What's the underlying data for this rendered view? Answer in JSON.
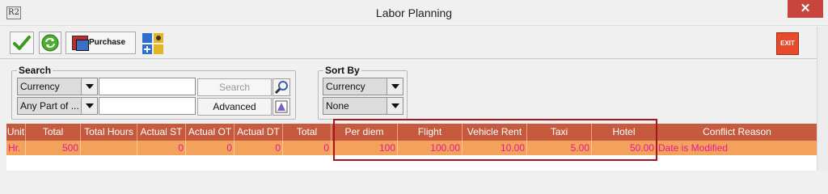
{
  "window": {
    "title": "Labor Planning",
    "close_glyph": "✕",
    "app_icon_text": "R2"
  },
  "toolbar": {
    "purchase_label": "Purchase",
    "exit_label": "EXIT"
  },
  "search": {
    "legend": "Search",
    "field_select": "Currency",
    "match_select": "Any Part of ...",
    "search_label": "Search",
    "advanced_label": "Advanced"
  },
  "sort": {
    "legend": "Sort By",
    "primary": "Currency",
    "secondary": "None"
  },
  "grid": {
    "columns": [
      "Unit",
      "Total",
      "Total Hours",
      "Actual ST",
      "Actual OT",
      "Actual DT",
      "Total",
      "Per diem",
      "Flight",
      "Vehicle Rent",
      "Taxi",
      "Hotel",
      "Conflict Reason"
    ],
    "row": [
      "Hr.",
      "500",
      "",
      "0",
      "0",
      "0",
      "0",
      "100",
      "100.00",
      "10.00",
      "5.00",
      "50.00",
      "Date is Modified"
    ]
  },
  "colors": {
    "header": "#c55a3e",
    "row": "#f3a25c",
    "row_text": "#e8179e",
    "highlight": "#a8151d"
  },
  "icons": [
    "checkmark-icon",
    "refresh-icon",
    "purchase-icon",
    "travel-expense-icon",
    "exit-icon",
    "magnifier-icon",
    "advanced-filter-icon",
    "dropdown-arrow-icon"
  ]
}
